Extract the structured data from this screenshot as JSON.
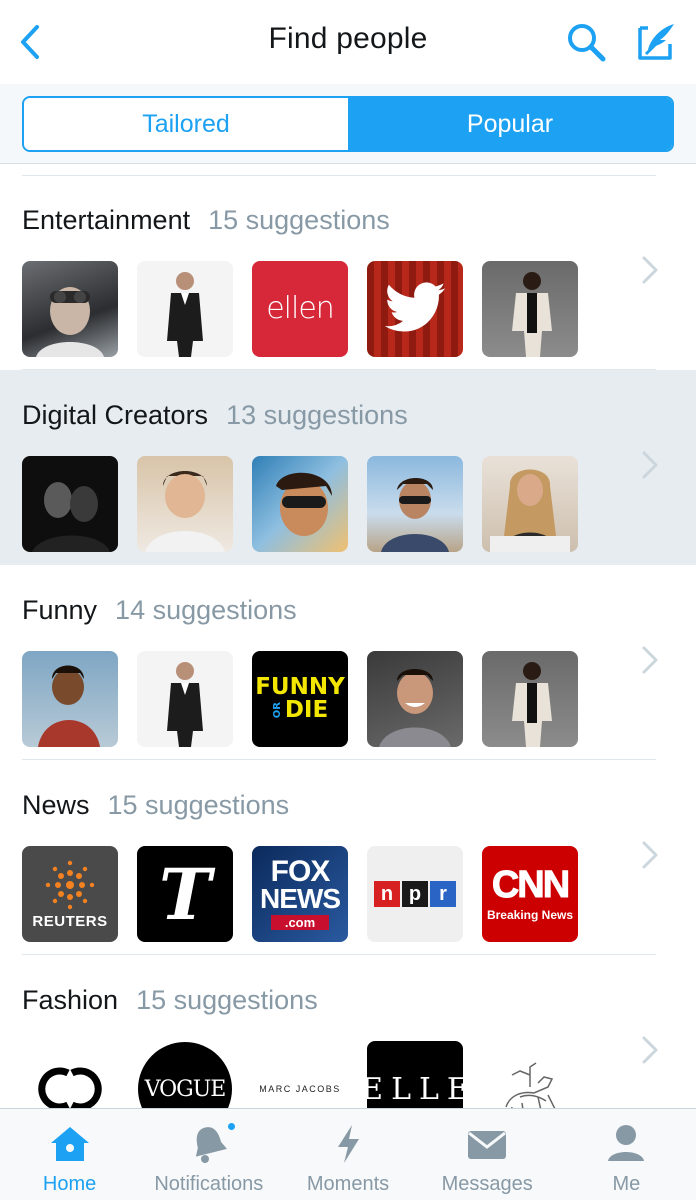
{
  "header": {
    "title": "Find people",
    "back_icon": "back-chevron-icon",
    "search_icon": "search-icon",
    "compose_icon": "compose-icon"
  },
  "segments": [
    {
      "label": "Tailored",
      "selected": false
    },
    {
      "label": "Popular",
      "selected": true
    }
  ],
  "categories": [
    {
      "title": "Entertainment",
      "count": "15 suggestions",
      "highlighted": false,
      "thumbs": [
        "person-photo",
        "person-suit-photo",
        "ellen-logo",
        "twitter-theater-logo",
        "person-suit-photo"
      ]
    },
    {
      "title": "Digital Creators",
      "count": "13 suggestions",
      "highlighted": true,
      "thumbs": [
        "person-bw-photo",
        "person-hoodie-photo",
        "person-sunglasses-photo",
        "person-outdoor-photo",
        "person-woman-photo"
      ]
    },
    {
      "title": "Funny",
      "count": "14 suggestions",
      "highlighted": false,
      "thumbs": [
        "child-photo",
        "person-suit-photo",
        "funny-or-die-logo",
        "person-smiling-photo",
        "person-suit-photo"
      ]
    },
    {
      "title": "News",
      "count": "15 suggestions",
      "highlighted": false,
      "thumbs": [
        "reuters-logo",
        "nyt-logo",
        "fox-news-logo",
        "npr-logo",
        "cnn-logo"
      ]
    },
    {
      "title": "Fashion",
      "count": "15 suggestions",
      "highlighted": false,
      "thumbs": [
        "chanel-logo",
        "vogue-logo",
        "marc-jacobs-logo",
        "elle-logo",
        "burberry-logo"
      ]
    }
  ],
  "logos": {
    "ellen": "ellen",
    "funny1": "FUNNY",
    "funny_or": "OR",
    "funny_die": "DIE",
    "reuters": "REUTERS",
    "nyt": "T",
    "fox1": "FOX",
    "fox2": "NEWS",
    "fox3": ".com",
    "npr": [
      "n",
      "p",
      "r"
    ],
    "cnn": "CNN",
    "cnn_sub": "Breaking News",
    "vogue": "VOGUE",
    "marc": "MARC JACOBS",
    "elle": "ELLE"
  },
  "tabbar": [
    {
      "label": "Home",
      "icon": "home-icon",
      "active": true
    },
    {
      "label": "Notifications",
      "icon": "bell-icon",
      "active": false,
      "badge": true
    },
    {
      "label": "Moments",
      "icon": "lightning-icon",
      "active": false
    },
    {
      "label": "Messages",
      "icon": "envelope-icon",
      "active": false
    },
    {
      "label": "Me",
      "icon": "person-icon",
      "active": false
    }
  ],
  "colors": {
    "accent": "#1da1f2",
    "muted": "#8899a6",
    "highlight_row": "#e6ecf0"
  }
}
